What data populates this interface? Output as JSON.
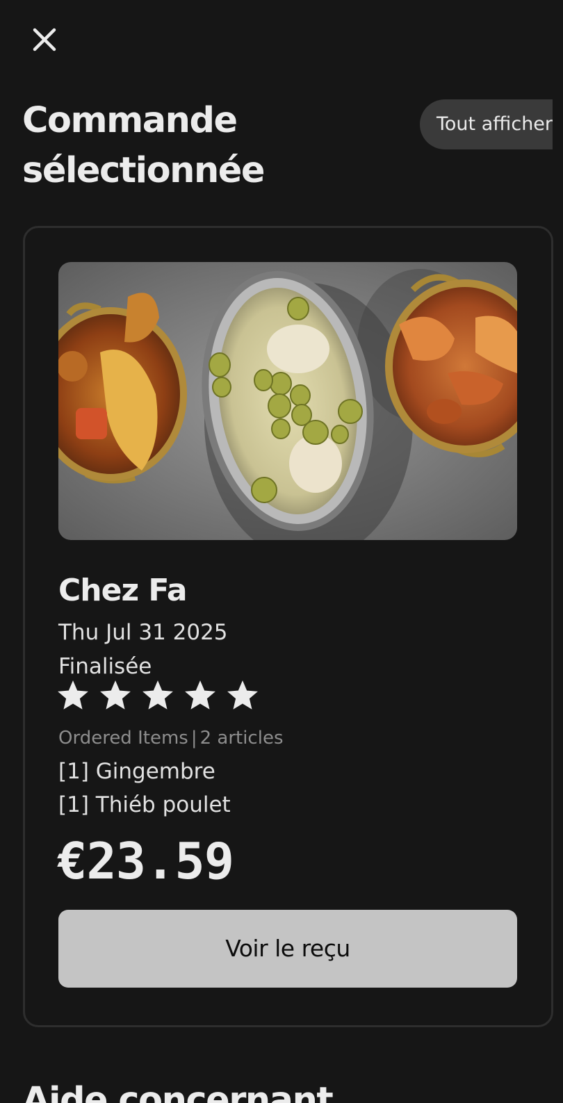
{
  "header": {
    "close_icon": "close-icon",
    "title": "Commande sélectionnée",
    "show_all_label": "Tout afficher"
  },
  "order": {
    "photo_description_icon": "food-photo",
    "restaurant_name": "Chez Fa",
    "date": "Thu Jul 31 2025",
    "status": "Finalisée",
    "rating": 5,
    "rating_max": 5,
    "items_label": "Ordered Items",
    "items_separator": "|",
    "items_count": "2 articles",
    "items": [
      "[1] Gingembre",
      "[1] Thiéb poulet"
    ],
    "total": "€23.59",
    "receipt_button_label": "Voir le reçu"
  },
  "next_section": {
    "title": "Aide concernant"
  },
  "colors": {
    "background": "#161616",
    "text": "#ececec",
    "muted_text": "#8e8e8e",
    "pill_background": "#3a3a3a",
    "card_border": "#2e2e2e",
    "button_background": "#c4c4c4",
    "button_text": "#0c0c0c"
  }
}
